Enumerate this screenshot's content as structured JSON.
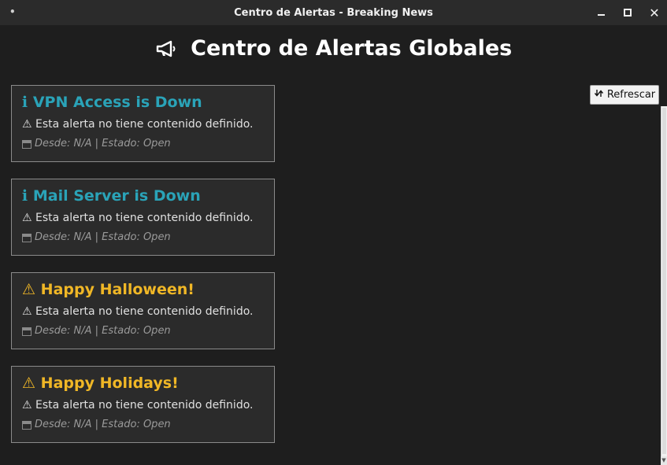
{
  "window": {
    "title": "Centro de Alertas - Breaking News",
    "menu_glyph": "•"
  },
  "header": {
    "title": "Centro de Alertas Globales",
    "icon": "megaphone-icon"
  },
  "toolbar": {
    "refresh_label": "Refrescar",
    "refresh_icon": "refresh-icon"
  },
  "colors": {
    "info": "#2aa3b8",
    "warning": "#f0b726",
    "background": "#1e1e1e",
    "card": "#2b2b2b"
  },
  "alerts": [
    {
      "icon": "ℹ",
      "title": "VPN Access is Down",
      "level": "info",
      "body": "⚠ Esta alerta no tiene contenido definido.",
      "meta": "Desde: N/A | Estado: Open"
    },
    {
      "icon": "ℹ",
      "title": "Mail Server is Down",
      "level": "info",
      "body": "⚠ Esta alerta no tiene contenido definido.",
      "meta": "Desde: N/A | Estado: Open"
    },
    {
      "icon": "⚠",
      "title": "Happy Halloween!",
      "level": "warn",
      "body": "⚠ Esta alerta no tiene contenido definido.",
      "meta": "Desde: N/A | Estado: Open"
    },
    {
      "icon": "⚠",
      "title": "Happy Holidays!",
      "level": "warn",
      "body": "⚠ Esta alerta no tiene contenido definido.",
      "meta": "Desde: N/A | Estado: Open"
    }
  ]
}
